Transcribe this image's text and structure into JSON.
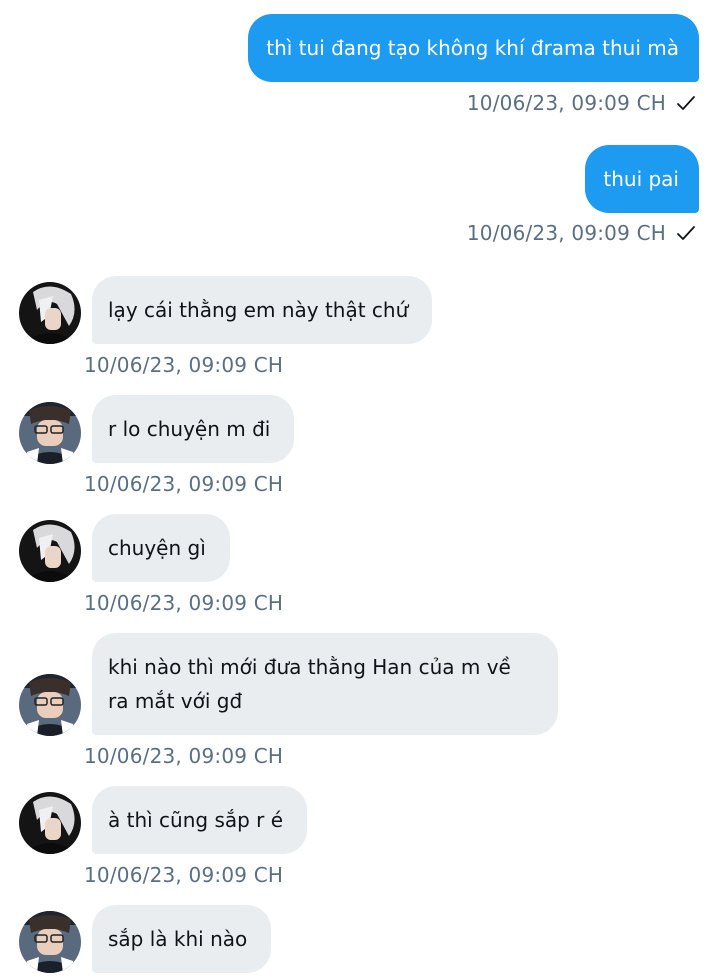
{
  "conversation": {
    "messages": [
      {
        "direction": "out",
        "text": "thì tui đang tạo không khí đrama thui mà",
        "time": "10/06/23,  09:09 CH"
      },
      {
        "direction": "out",
        "text": "thui pai",
        "time": "10/06/23,  09:09 CH"
      },
      {
        "direction": "in",
        "avatar": "avatar-a",
        "text": "lạy cái thằng em này thật chứ",
        "time": "10/06/23,  09:09 CH"
      },
      {
        "direction": "in",
        "avatar": "avatar-b",
        "text": "r lo chuyện m đi",
        "time": "10/06/23,  09:09 CH"
      },
      {
        "direction": "in",
        "avatar": "avatar-a",
        "text": "chuyện gì",
        "time": "10/06/23,  09:09 CH"
      },
      {
        "direction": "in",
        "avatar": "avatar-b",
        "text": "khi nào thì mới đưa thằng Han của m về ra mắt với gđ",
        "time": "10/06/23,  09:09 CH"
      },
      {
        "direction": "in",
        "avatar": "avatar-a",
        "text": "à thì cũng sắp r é",
        "time": "10/06/23,  09:09 CH"
      },
      {
        "direction": "in",
        "avatar": "avatar-b",
        "text": "sắp là khi nào"
      }
    ]
  },
  "colors": {
    "outgoing_bubble": "#1d9bf0",
    "incoming_bubble": "#e9edf0",
    "timestamp": "#5b6f82"
  },
  "icons": {
    "read_receipt": "check-icon"
  }
}
